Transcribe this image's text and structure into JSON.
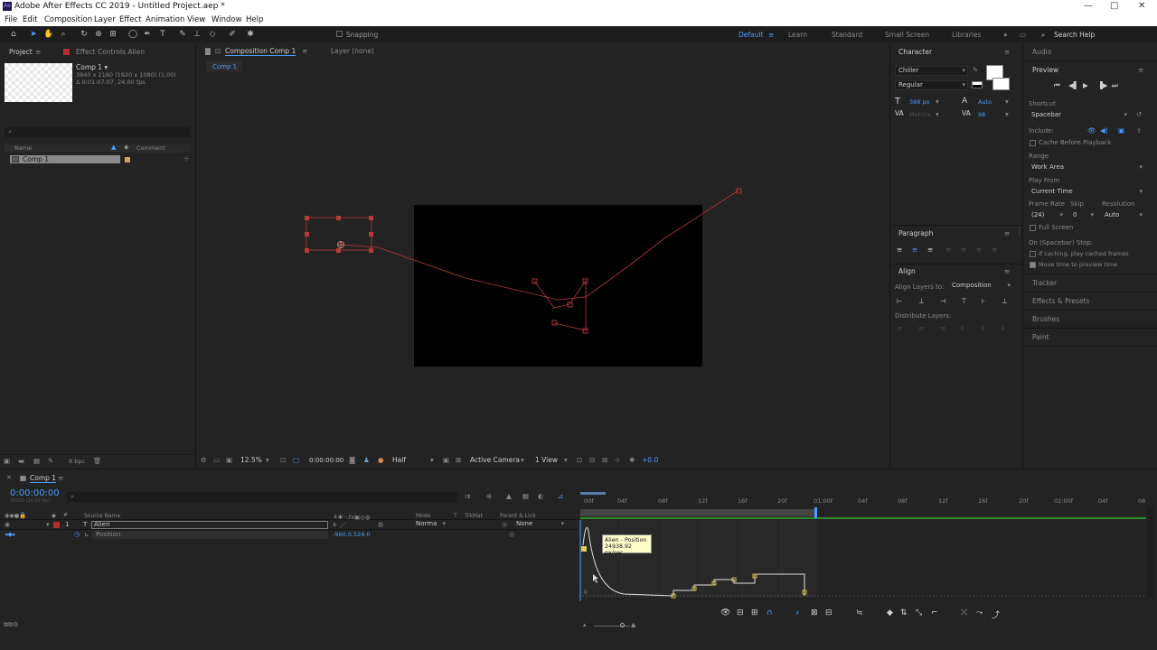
{
  "titlebar": {
    "title": "Adobe After Effects CC 2019 - Untitled Project.aep *",
    "logo": "Ae",
    "min": "—",
    "max": "▢",
    "close": "✕"
  },
  "menu": [
    "File",
    "Edit",
    "Composition",
    "Layer",
    "Effect",
    "Animation",
    "View",
    "Window",
    "Help"
  ],
  "toolbar": {
    "snapping": "Snapping",
    "workspaces": [
      "Default",
      "Learn",
      "Standard",
      "Small Screen",
      "Libraries"
    ],
    "search_placeholder": "Search Help",
    "more": "»"
  },
  "project": {
    "tab_project": "Project",
    "tab_effects": "Effect Controls Alien",
    "comp_name": "Comp 1 ▾",
    "comp_res": "3840 x 2160  (1920 x 1080) (1.00)",
    "comp_dur": "Δ 0:01:07:07, 24.00 fps",
    "search_placeholder": "",
    "col_name": "Name",
    "col_comment": "Comment",
    "item_name": "Comp 1",
    "bpc": "8 bpc"
  },
  "composition": {
    "tab": "Composition Comp 1",
    "layer_tab": "Layer (none)",
    "breadcrumb": "Comp 1"
  },
  "viewer_controls": {
    "zoom": "12.5%",
    "timecode": "0:00:00:00",
    "resolution": "Half",
    "camera": "Active Camera",
    "views": "1 View",
    "exposure": "+0.0"
  },
  "character": {
    "title": "Character",
    "font": "Chiller",
    "style": "Regular",
    "size": "388 px",
    "leading": "Auto",
    "kerning": "Metrics",
    "tracking": "98"
  },
  "paragraph": {
    "title": "Paragraph"
  },
  "align": {
    "title": "Align",
    "align_to_label": "Align Layers to:",
    "align_to": "Composition",
    "distribute": "Distribute Layers:"
  },
  "audio": {
    "title": "Audio"
  },
  "preview": {
    "title": "Preview",
    "shortcut_label": "Shortcut",
    "shortcut": "Spacebar",
    "include_label": "Include:",
    "cache_label": "Cache Before Playback",
    "range_label": "Range",
    "range": "Work Area",
    "play_from_label": "Play From",
    "play_from": "Current Time",
    "fr_label": "Frame Rate",
    "skip_label": "Skip",
    "res_label": "Resolution",
    "fr": "(24)",
    "skip": "0",
    "res": "Auto",
    "fullscreen": "Full Screen",
    "stop_label": "On (Spacebar) Stop:",
    "if_caching": "If caching, play cached frames",
    "move_time": "Move time to preview time"
  },
  "side_panels": [
    "Tracker",
    "Effects & Presets",
    "Brushes",
    "Paint"
  ],
  "timeline": {
    "tab": "Comp 1",
    "timecode": "0:00:00:00",
    "subtime": "00000 (24.00 fps)",
    "cols": {
      "source": "Source Name",
      "mode": "Mode",
      "t": "T",
      "trkmat": "TrkMat",
      "parent": "Parent & Link"
    },
    "layer": {
      "num": "1",
      "type": "T",
      "name": "Alien",
      "mode": "Norma",
      "parent": "None"
    },
    "prop": {
      "name": "Position",
      "value": "-960.0,524.0"
    },
    "ruler": [
      "00f",
      "04f",
      "08f",
      "12f",
      "16f",
      "20f",
      "01:00f",
      "04f",
      "08f",
      "12f",
      "16f",
      "20f",
      "02:00f",
      "04f",
      "08"
    ],
    "tooltip_title": "Alien - Position",
    "tooltip_value": "24938.92 px/sec",
    "graph_zero": "0"
  }
}
